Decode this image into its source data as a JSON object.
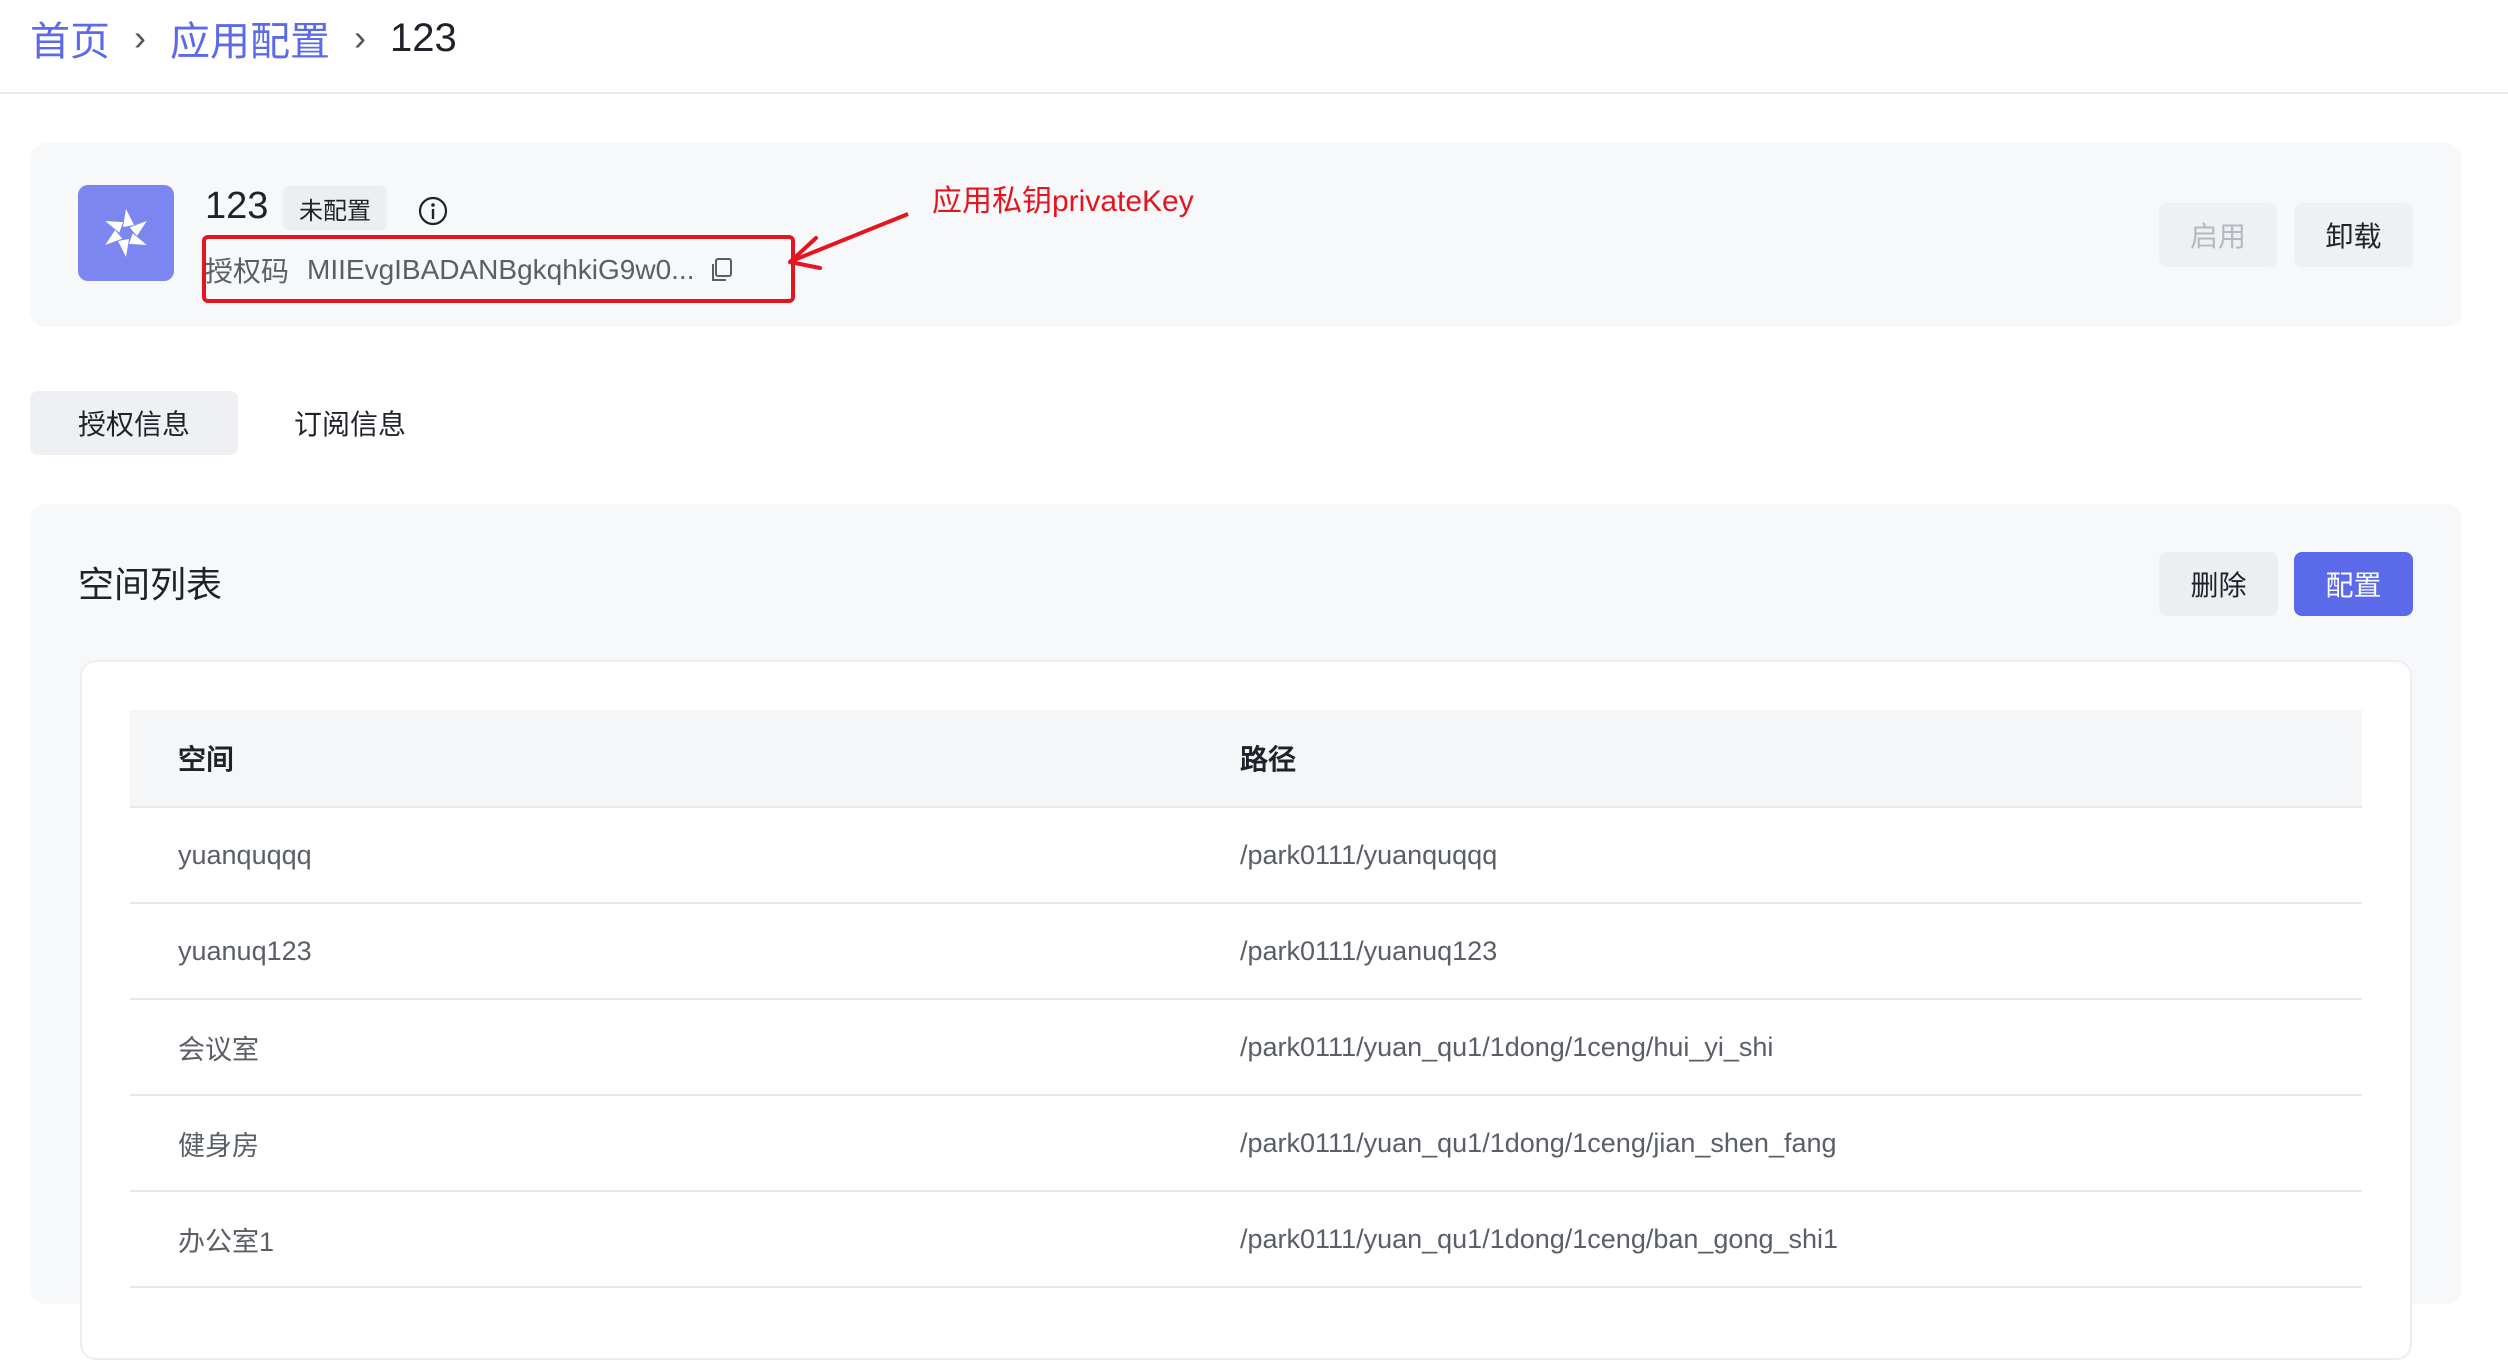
{
  "breadcrumb": {
    "home": "首页",
    "app_config": "应用配置",
    "current": "123",
    "separator": "›"
  },
  "app": {
    "name": "123",
    "status": "未配置",
    "auth_label": "授权码",
    "auth_code": "MIIEvgIBADANBgkqhkiG9w0...",
    "annotation": "应用私钥privateKey",
    "enable_label": "启用",
    "uninstall_label": "卸载"
  },
  "tabs": [
    {
      "label": "授权信息",
      "active": true
    },
    {
      "label": "订阅信息",
      "active": false
    }
  ],
  "space_list": {
    "title": "空间列表",
    "delete_label": "删除",
    "config_label": "配置",
    "columns": [
      "空间",
      "路径"
    ],
    "rows": [
      {
        "space": "yuanquqqq",
        "path": "/park0111/yuanquqqq"
      },
      {
        "space": "yuanuq123",
        "path": "/park0111/yuanuq123"
      },
      {
        "space": "会议室",
        "path": "/park0111/yuan_qu1/1dong/1ceng/hui_yi_shi"
      },
      {
        "space": "健身房",
        "path": "/park0111/yuan_qu1/1dong/1ceng/jian_shen_fang"
      },
      {
        "space": "办公室1",
        "path": "/park0111/yuan_qu1/1dong/1ceng/ban_gong_shi1"
      }
    ]
  },
  "colors": {
    "accent": "#5b6ae8",
    "annotation_red": "#e5141e",
    "logo_bg": "#7b86f0"
  },
  "icons": {
    "breadcrumb_separator": "chevron-right-icon",
    "info": "info-icon",
    "copy": "copy-icon",
    "logo": "app-logo-icon",
    "annotation": "arrow-icon"
  }
}
